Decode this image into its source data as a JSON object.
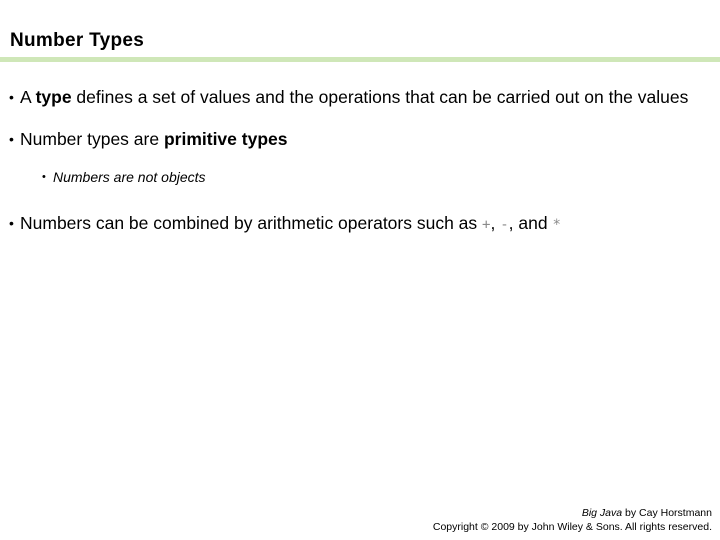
{
  "slide": {
    "title": "Number Types",
    "accent_color": "#cfe7b8",
    "background_color": "#ffffff",
    "text_color": "#000000",
    "operator_color": "#8a8a8a",
    "bullet_glyph": "•",
    "sub_bullet_glyph": "•"
  },
  "bullets": [
    {
      "pre": "A ",
      "emphasis": "type",
      "post": " defines a set of values and the operations that can be carried out on the values"
    },
    {
      "pre": "Number types are ",
      "emphasis": "primitive types",
      "post": ""
    },
    {
      "pre": "Numbers can be combined by arithmetic operators such as ",
      "op1": "+",
      "sep1": ", ",
      "op2": "-",
      "sep2": ", and ",
      "op3": "*",
      "post": ""
    }
  ],
  "sub_bullet": {
    "text": "Numbers are not objects"
  },
  "footer": {
    "source_title": "Big Java",
    "source_byline": " by Cay Horstmann",
    "copyright": "Copyright © 2009 by John Wiley & Sons.  All rights reserved."
  }
}
